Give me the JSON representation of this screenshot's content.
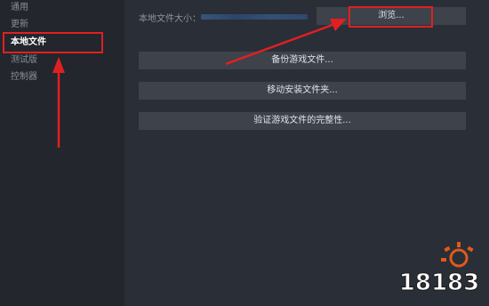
{
  "sidebar": {
    "items": [
      {
        "label": "通用"
      },
      {
        "label": "更新"
      },
      {
        "label": "本地文件"
      },
      {
        "label": "测试版"
      },
      {
        "label": "控制器"
      }
    ]
  },
  "local_files": {
    "size_label": "本地文件大小：",
    "browse_label": "浏览...",
    "backup_label": "备份游戏文件...",
    "move_label": "移动安装文件夹...",
    "verify_label": "验证游戏文件的完整性..."
  },
  "watermark": {
    "text": "18183"
  },
  "colors": {
    "annotation_red": "#e02020",
    "button_bg": "#3d424b",
    "sidebar_bg": "#23262d",
    "content_bg": "#2a2e37"
  }
}
